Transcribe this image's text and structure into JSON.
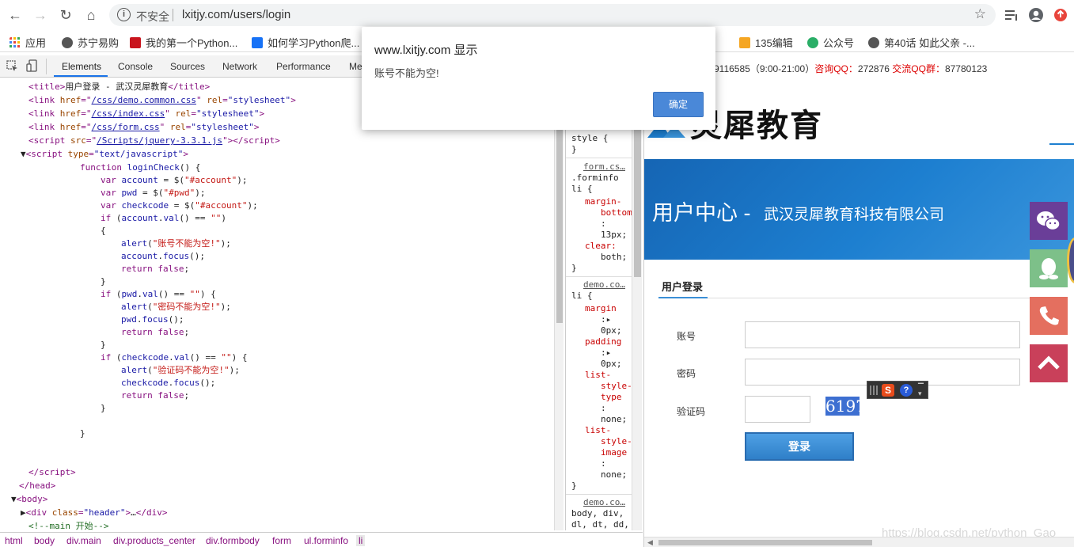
{
  "browser": {
    "insecure_label": "不安全",
    "url": "lxitjy.com/users/login"
  },
  "bookmarks": [
    {
      "label": "应用",
      "color": "#e8453c"
    },
    {
      "label": "苏宁易购",
      "color": "#555555"
    },
    {
      "label": "我的第一个Python...",
      "color": "#c9151e"
    },
    {
      "label": "如何学习Python爬...",
      "color": "#1772f6"
    },
    {
      "label": "135编辑",
      "color": "#f5a623"
    },
    {
      "label": "公众号",
      "color": "#2aae67"
    },
    {
      "label": "第40话 如此父亲 -...",
      "color": "#555555"
    }
  ],
  "devtools": {
    "tabs": [
      "Elements",
      "Console",
      "Sources",
      "Network",
      "Performance",
      "Me"
    ],
    "code": {
      "title_text": "用户登录 - 武汉灵犀教育",
      "link1": "/css/demo.common.css",
      "link2": "/css/index.css",
      "link3": "/css/form.css",
      "script_src": "/Scripts/jquery-3.3.1.js",
      "alert1": "\"账号不能为空!\"",
      "alert2": "\"密码不能为空!\"",
      "alert3": "\"验证码不能为空!\"",
      "comment_main": "<!--main 开始-->"
    },
    "styles": {
      "src1": "form.cs…",
      "src2": "demo.co…",
      "src3": "demo.co…"
    },
    "breadcrumbs": [
      "html",
      "body",
      "div.main",
      "div.products_center",
      "div.formbody",
      "form",
      "ul.forminfo",
      "li"
    ]
  },
  "page": {
    "contact_phone": "9116585（9:00-21:00）",
    "contact_qq": "咨询QQ：",
    "contact_qq_num": "272876",
    "contact_group": "交流QQ群：",
    "contact_group_num": "87780123",
    "logo_text": "灵犀教育",
    "banner_title": "用户中心 -",
    "banner_subtitle": "武汉灵犀教育科技有限公司",
    "form_title": "用户登录",
    "account_label": "账号",
    "password_label": "密码",
    "captcha_label": "验证码",
    "captcha_value": "6197",
    "login_button": "登录",
    "watermark": "https://blog.csdn.net/python_Gao"
  },
  "dialog": {
    "title": "www.lxitjy.com 显示",
    "message": "账号不能为空!",
    "ok_label": "确定"
  },
  "colors": {
    "accent": "#4a88d8",
    "banner": "#1d7fd0",
    "side_wechat": "#6a3e98",
    "side_qq": "#7dc089",
    "side_phone": "#e46f5f",
    "side_top": "#c9405a"
  }
}
